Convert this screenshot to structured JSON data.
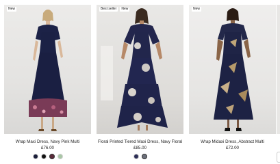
{
  "products": [
    {
      "badges": [
        "New"
      ],
      "title": "Wrap Maxi Dress, Navy Pink Multi",
      "price": "£76.00",
      "swatches": [
        "#1b1f3a",
        "#121212",
        "#5b2a3a",
        "#a9c7a6"
      ],
      "selected_swatch": 2,
      "image_icon": "model-photo"
    },
    {
      "badges": [
        "Best seller",
        "New"
      ],
      "title": "Floral Printed Tiered Maxi Dress, Navy Floral",
      "price": "£85.00",
      "swatches": [
        "#2d2f57",
        "#6b6f7a"
      ],
      "selected_swatch": 1,
      "image_icon": "model-photo"
    },
    {
      "badges": [
        "New"
      ],
      "title": "Wrap Midaxi Dress, Abstract Multi",
      "price": "£72.00",
      "swatches": [],
      "selected_swatch": -1,
      "image_icon": "model-photo"
    }
  ],
  "colors": {
    "background": "#ffffff",
    "text": "#222222",
    "photo_bg": "#e6e5e3"
  }
}
